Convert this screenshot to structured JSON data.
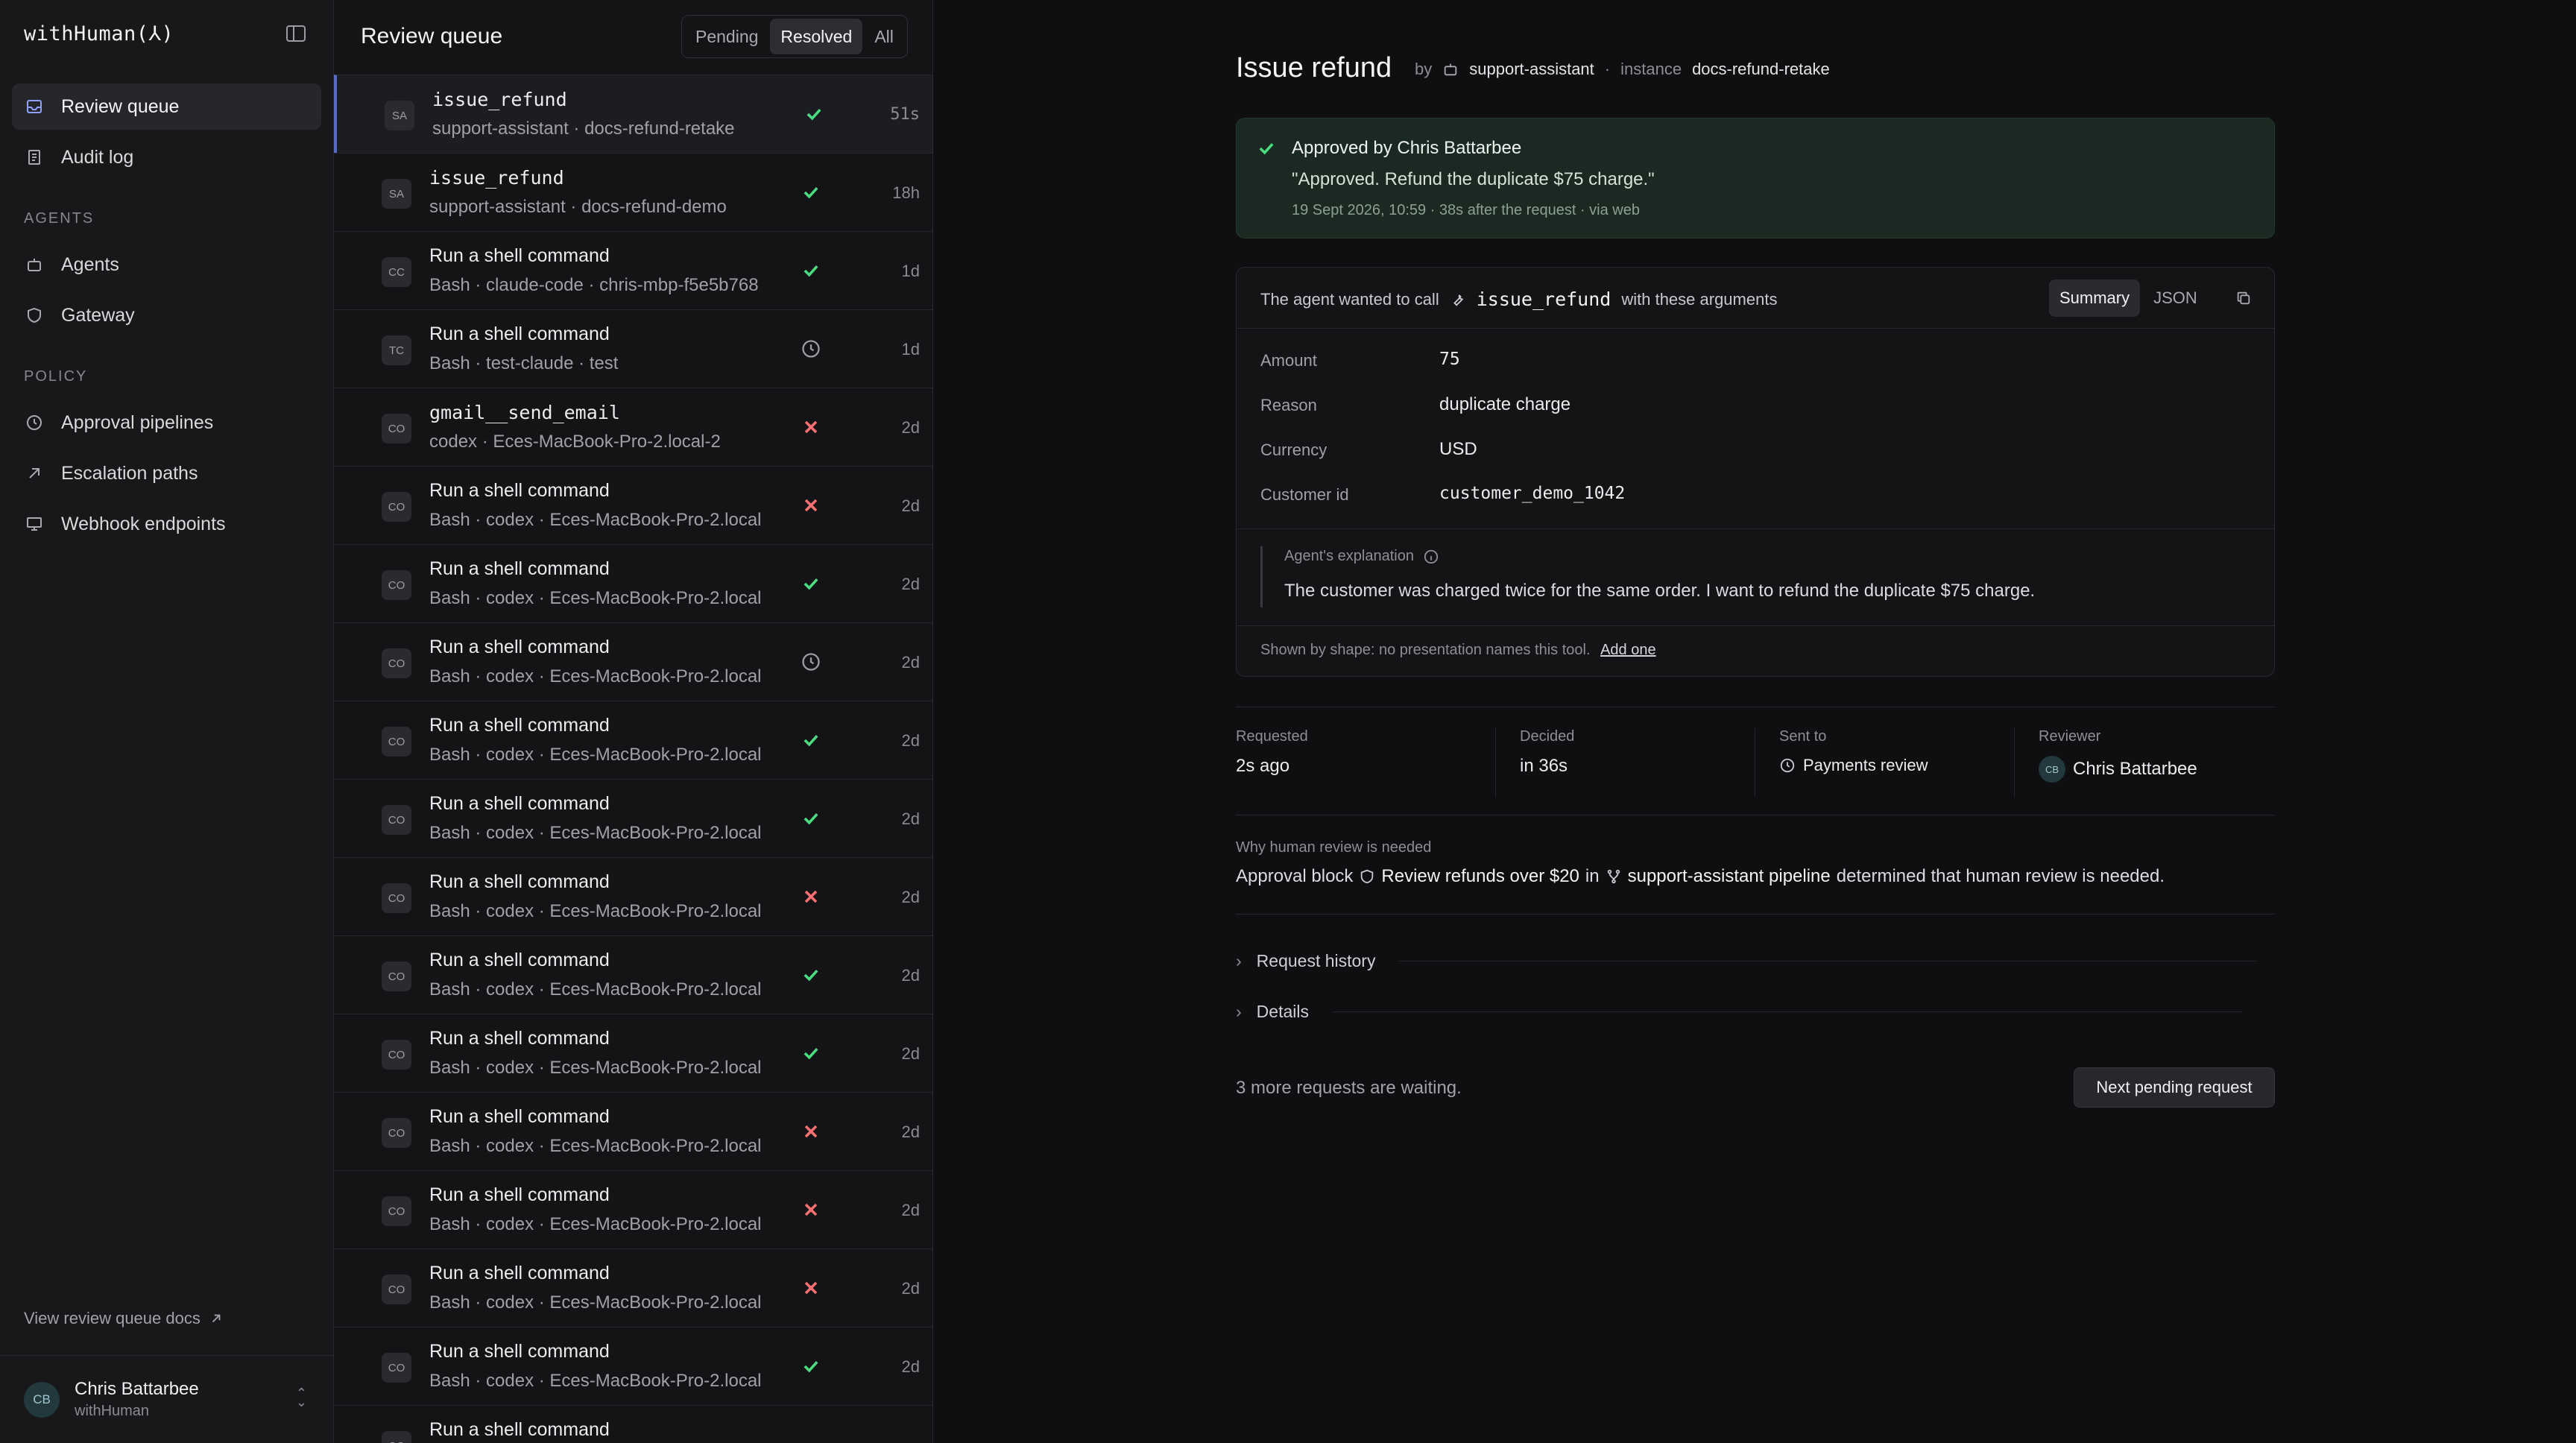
{
  "brand": "withHuman(⅄)",
  "nav": {
    "review_queue": "Review queue",
    "audit_log": "Audit log",
    "agents_section": "AGENTS",
    "agents": "Agents",
    "gateway": "Gateway",
    "policy_section": "POLICY",
    "approval_pipelines": "Approval pipelines",
    "escalation_paths": "Escalation paths",
    "webhook_endpoints": "Webhook endpoints",
    "docs_link": "View review queue docs"
  },
  "user": {
    "initials": "CB",
    "name": "Chris Battarbee",
    "org": "withHuman"
  },
  "queue": {
    "title": "Review queue",
    "filters": [
      "Pending",
      "Resolved",
      "All"
    ],
    "active_filter": "Resolved",
    "rows": [
      {
        "badge": "SA",
        "title": "issue_refund",
        "mono": true,
        "sub": "support-assistant · docs-refund-retake",
        "status": "approved",
        "time": "51s"
      },
      {
        "badge": "SA",
        "title": "issue_refund",
        "mono": true,
        "sub": "support-assistant · docs-refund-demo",
        "status": "approved",
        "time": "18h"
      },
      {
        "badge": "CC",
        "title": "Run a shell command",
        "mono": false,
        "sub": "Bash · claude-code · chris-mbp-f5e5b768",
        "status": "approved",
        "time": "1d"
      },
      {
        "badge": "TC",
        "title": "Run a shell command",
        "mono": false,
        "sub": "Bash · test-claude · test",
        "status": "pending",
        "time": "1d"
      },
      {
        "badge": "CO",
        "title": "gmail__send_email",
        "mono": true,
        "sub": "codex · Eces-MacBook-Pro-2.local-2",
        "status": "rejected",
        "time": "2d"
      },
      {
        "badge": "CO",
        "title": "Run a shell command",
        "mono": false,
        "sub": "Bash · codex · Eces-MacBook-Pro-2.local",
        "status": "rejected",
        "time": "2d"
      },
      {
        "badge": "CO",
        "title": "Run a shell command",
        "mono": false,
        "sub": "Bash · codex · Eces-MacBook-Pro-2.local",
        "status": "approved",
        "time": "2d"
      },
      {
        "badge": "CO",
        "title": "Run a shell command",
        "mono": false,
        "sub": "Bash · codex · Eces-MacBook-Pro-2.local",
        "status": "pending",
        "time": "2d"
      },
      {
        "badge": "CO",
        "title": "Run a shell command",
        "mono": false,
        "sub": "Bash · codex · Eces-MacBook-Pro-2.local",
        "status": "approved",
        "time": "2d"
      },
      {
        "badge": "CO",
        "title": "Run a shell command",
        "mono": false,
        "sub": "Bash · codex · Eces-MacBook-Pro-2.local",
        "status": "approved",
        "time": "2d"
      },
      {
        "badge": "CO",
        "title": "Run a shell command",
        "mono": false,
        "sub": "Bash · codex · Eces-MacBook-Pro-2.local",
        "status": "rejected",
        "time": "2d"
      },
      {
        "badge": "CO",
        "title": "Run a shell command",
        "mono": false,
        "sub": "Bash · codex · Eces-MacBook-Pro-2.local",
        "status": "approved",
        "time": "2d"
      },
      {
        "badge": "CO",
        "title": "Run a shell command",
        "mono": false,
        "sub": "Bash · codex · Eces-MacBook-Pro-2.local",
        "status": "approved",
        "time": "2d"
      },
      {
        "badge": "CO",
        "title": "Run a shell command",
        "mono": false,
        "sub": "Bash · codex · Eces-MacBook-Pro-2.local",
        "status": "rejected",
        "time": "2d"
      },
      {
        "badge": "CO",
        "title": "Run a shell command",
        "mono": false,
        "sub": "Bash · codex · Eces-MacBook-Pro-2.local",
        "status": "rejected",
        "time": "2d"
      },
      {
        "badge": "CO",
        "title": "Run a shell command",
        "mono": false,
        "sub": "Bash · codex · Eces-MacBook-Pro-2.local",
        "status": "rejected",
        "time": "2d"
      },
      {
        "badge": "CO",
        "title": "Run a shell command",
        "mono": false,
        "sub": "Bash · codex · Eces-MacBook-Pro-2.local",
        "status": "approved",
        "time": "2d"
      },
      {
        "badge": "CO",
        "title": "Run a shell command",
        "mono": false,
        "sub": "",
        "status": "",
        "time": ""
      }
    ]
  },
  "detail": {
    "title": "Issue refund",
    "by_label": "by",
    "agent": "support-assistant",
    "dot": "·",
    "instance_label": "instance",
    "instance": "docs-refund-retake",
    "approval": {
      "title": "Approved by Chris Battarbee",
      "quote": "\"Approved. Refund the duplicate $75 charge.\"",
      "meta": "19 Sept 2026, 10:59  ·  38s after the request  ·  via web"
    },
    "args": {
      "intro": "The agent wanted to call",
      "tool": "issue_refund",
      "outro": "with these arguments",
      "tabs": [
        "Summary",
        "JSON"
      ],
      "fields": [
        {
          "label": "Amount",
          "value": "75",
          "mono": true
        },
        {
          "label": "Reason",
          "value": "duplicate charge",
          "mono": false
        },
        {
          "label": "Currency",
          "value": "USD",
          "mono": false
        },
        {
          "label": "Customer id",
          "value": "customer_demo_1042",
          "mono": true
        }
      ],
      "explanation_label": "Agent's explanation",
      "explanation": "The customer was charged twice for the same order. I want to refund the duplicate $75 charge.",
      "shape_note": "Shown by shape: no presentation names this tool.",
      "shape_link": "Add one"
    },
    "meta": {
      "requested_label": "Requested",
      "requested": "2s ago",
      "decided_label": "Decided",
      "decided": "in 36s",
      "sent_label": "Sent to",
      "sent": "Payments review",
      "reviewer_label": "Reviewer",
      "reviewer_initials": "CB",
      "reviewer": "Chris Battarbee"
    },
    "why": {
      "label": "Why human review is needed",
      "prefix": "Approval block",
      "block": "Review refunds over $20",
      "mid": "in",
      "pipeline": "support-assistant pipeline",
      "suffix": "determined that human review is needed."
    },
    "request_history": "Request history",
    "details": "Details",
    "waiting": "3 more requests are waiting.",
    "next_button": "Next pending request"
  },
  "colors": {
    "approved": "#4ade80",
    "rejected": "#f87171",
    "pending": "#9b9ba1",
    "accent": "#5a6bc4"
  }
}
